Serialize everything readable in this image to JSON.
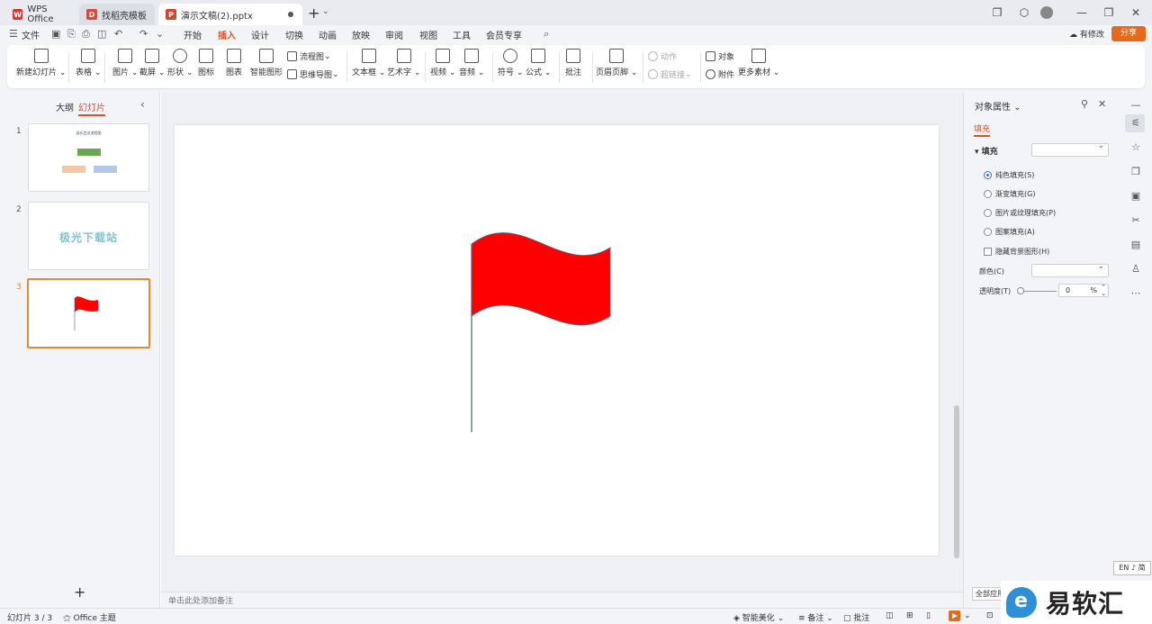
{
  "titlebar": {
    "tabs": [
      {
        "label": "WPS Office"
      },
      {
        "label": "找稻壳模板"
      },
      {
        "label": "演示文稿(2).pptx"
      }
    ]
  },
  "menubar": {
    "file": "文件",
    "items": [
      "开始",
      "插入",
      "设计",
      "切换",
      "动画",
      "放映",
      "审阅",
      "视图",
      "工具",
      "会员专享"
    ],
    "active": "插入",
    "has_edit": "有修改",
    "share": "分享"
  },
  "ribbon": {
    "new_slide": "新建幻灯片",
    "table": "表格",
    "picture": "图片",
    "screenshot": "截屏",
    "shape": "形状",
    "icon": "图标",
    "chart": "图表",
    "smartart": "智能图形",
    "flowchart": "流程图",
    "mindmap": "思维导图",
    "textbox": "文本框",
    "wordart": "艺术字",
    "video": "视频",
    "audio": "音频",
    "symbol": "符号",
    "formula": "公式",
    "comment": "批注",
    "header_footer": "页眉页脚",
    "action": "动作",
    "hyperlink": "超链接",
    "object": "对象",
    "attachment": "附件",
    "more_material": "更多素材"
  },
  "leftpanel": {
    "outline_tab": "大纲",
    "slides_tab": "幻灯片",
    "slides": [
      {
        "num": "1",
        "title": "部长会议流程图"
      },
      {
        "num": "2",
        "text": "极光下载站"
      },
      {
        "num": "3"
      }
    ]
  },
  "slide": {
    "flag_color": "#ff0000",
    "pole_color": "#4a6d8c"
  },
  "notes": {
    "placeholder": "单击此处添加备注"
  },
  "rightpanel": {
    "title": "对象属性",
    "tab": "填充",
    "section": "填充",
    "options": [
      {
        "label": "纯色填充(S)",
        "checked": true
      },
      {
        "label": "渐变填充(G)",
        "checked": false
      },
      {
        "label": "图片或纹理填充(P)",
        "checked": false
      },
      {
        "label": "图案填充(A)",
        "checked": false
      }
    ],
    "hide_bg": "隐藏背景图形(H)",
    "color_label": "颜色(C)",
    "transparency_label": "透明度(T)",
    "transparency_value": "0",
    "transparency_unit": "%",
    "apply_all": "全部应用"
  },
  "statusbar": {
    "slide_count": "幻灯片 3 / 3",
    "theme": "Office 主题",
    "beautify": "智能美化",
    "notes": "备注",
    "comments": "批注"
  },
  "ime": {
    "label": "EN ♪ 简"
  },
  "watermark": {
    "text": "易软汇"
  }
}
